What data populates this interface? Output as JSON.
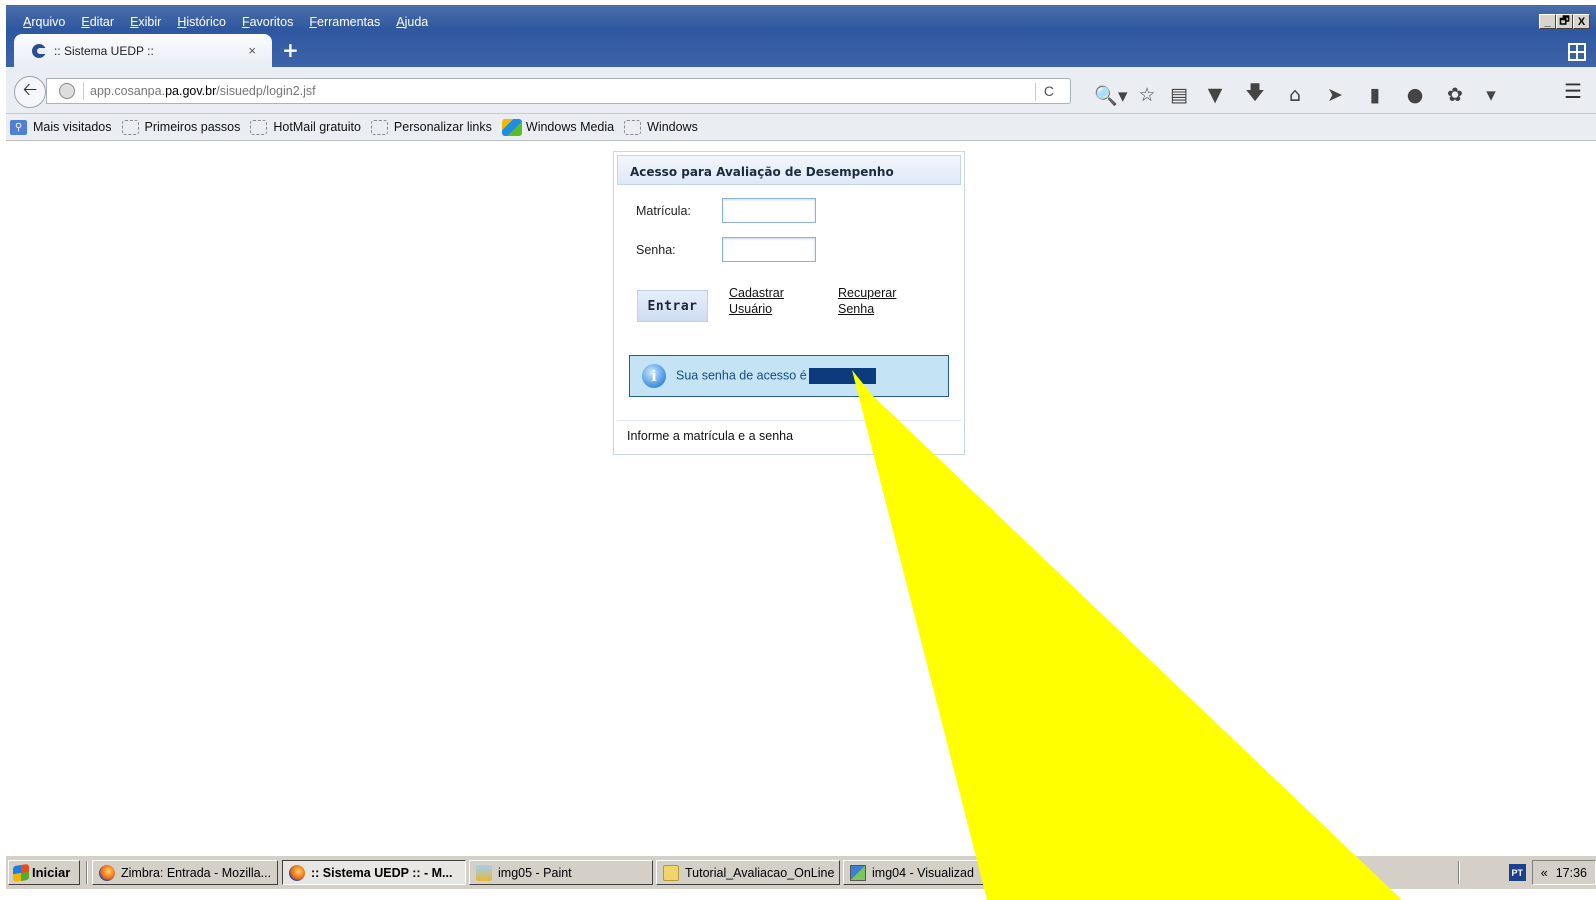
{
  "browser": {
    "menu": [
      "Arquivo",
      "Editar",
      "Exibir",
      "Histórico",
      "Favoritos",
      "Ferramentas",
      "Ajuda"
    ],
    "window_controls": [
      "_",
      "🗗",
      "X"
    ],
    "tab_title": ":: Sistema UEDP ::",
    "tab_close": "×",
    "new_tab": "+",
    "url": {
      "prefix": "app.cosanpa.",
      "domain": "pa.gov.br",
      "path": "/sisuedp/login2.jsf"
    },
    "reload_icon": "C",
    "bookmarks": [
      "Mais visitados",
      "Primeiros passos",
      "HotMail gratuito",
      "Personalizar links",
      "Windows Media",
      "Windows"
    ]
  },
  "login": {
    "header": "Acesso para Avaliação de Desempenho",
    "matricula_label": "Matrícula:",
    "senha_label": "Senha:",
    "matricula_value": "",
    "senha_value": "",
    "entrar_button": "Entrar",
    "cadastrar_line1": "Cadastrar",
    "cadastrar_line2": "Usuário",
    "recuperar_line1": "Recuperar",
    "recuperar_line2": "Senha",
    "info_message": "Sua senha de acesso é",
    "info_icon": "i",
    "footer": "Informe a matrícula e a senha"
  },
  "annotation": {
    "arrow_color": "#ffff00"
  },
  "taskbar": {
    "start": "Iniciar",
    "tasks": [
      "Zimbra: Entrada - Mozilla...",
      ":: Sistema UEDP :: - M...",
      "img05 - Paint",
      "Tutorial_Avaliacao_OnLine",
      "img04 - Visualizad"
    ],
    "lang": "PT",
    "chevron": "«",
    "clock": "17:36"
  }
}
